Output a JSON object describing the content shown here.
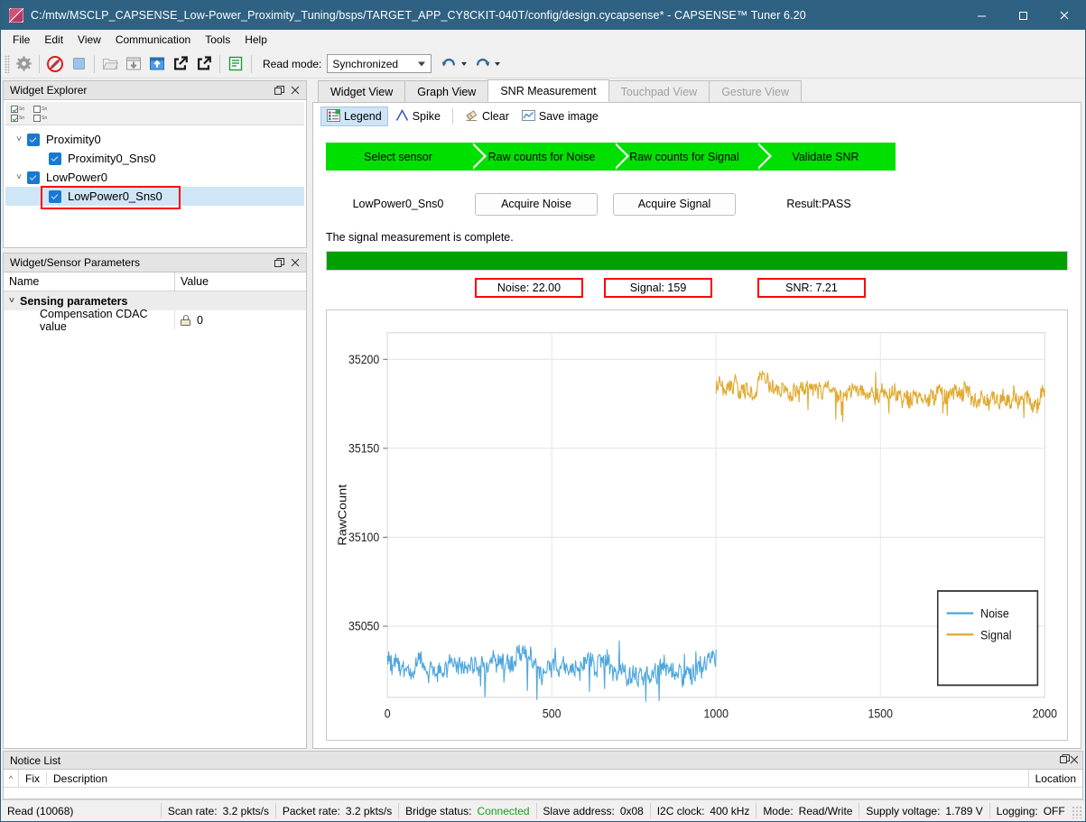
{
  "window": {
    "title": "C:/mtw/MSCLP_CAPSENSE_Low-Power_Proximity_Tuning/bsps/TARGET_APP_CY8CKIT-040T/config/design.cycapsense* - CAPSENSE™ Tuner 6.20",
    "minimize": "—",
    "maximize": "□",
    "close": "✕"
  },
  "menu": {
    "items": [
      "File",
      "Edit",
      "View",
      "Communication",
      "Tools",
      "Help"
    ]
  },
  "toolbar": {
    "icons": [
      "gear-icon",
      "disconnect-icon",
      "stop-icon",
      "open-file-icon",
      "read-from-device-icon",
      "write-to-device-icon",
      "import-icon",
      "export-icon",
      "log-icon"
    ],
    "read_mode_label": "Read mode:",
    "read_mode_value": "Synchronized",
    "undo_label": "Undo",
    "redo_label": "Redo"
  },
  "widget_explorer": {
    "title": "Widget Explorer",
    "check_all_label": "Sn",
    "uncheck_all_label": "Sn",
    "tree": [
      {
        "label": "Proximity0",
        "level": 0,
        "expander": "˅",
        "checked": true,
        "selected": false,
        "highlight": false
      },
      {
        "label": "Proximity0_Sns0",
        "level": 1,
        "expander": "",
        "checked": true,
        "selected": false,
        "highlight": false
      },
      {
        "label": "LowPower0",
        "level": 0,
        "expander": "˅",
        "checked": true,
        "selected": false,
        "highlight": false
      },
      {
        "label": "LowPower0_Sns0",
        "level": 1,
        "expander": "",
        "checked": true,
        "selected": true,
        "highlight": true
      }
    ]
  },
  "params": {
    "title": "Widget/Sensor Parameters",
    "columns": [
      "Name",
      "Value"
    ],
    "group": "Sensing parameters",
    "group_expander": "˅",
    "rows": [
      {
        "name": "Compensation CDAC value",
        "value": "0",
        "locked": true
      }
    ]
  },
  "tabs": [
    {
      "label": "Widget View",
      "active": false,
      "disabled": false
    },
    {
      "label": "Graph View",
      "active": false,
      "disabled": false
    },
    {
      "label": "SNR Measurement",
      "active": true,
      "disabled": false
    },
    {
      "label": "Touchpad View",
      "active": false,
      "disabled": true
    },
    {
      "label": "Gesture View",
      "active": false,
      "disabled": true
    }
  ],
  "subtoolbar": [
    {
      "label": "Legend",
      "icon": "legend-icon",
      "active": true
    },
    {
      "label": "Spike",
      "icon": "spike-icon",
      "active": false
    },
    {
      "label": "Clear",
      "icon": "eraser-icon",
      "active": false
    },
    {
      "label": "Save image",
      "icon": "save-image-icon",
      "active": false
    }
  ],
  "snr": {
    "steps": [
      "Select sensor",
      "Raw counts for Noise",
      "Raw counts for Signal",
      "Validate SNR"
    ],
    "step_color": "#00e000",
    "sensor_name": "LowPower0_Sns0",
    "acquire_noise_label": "Acquire Noise",
    "acquire_signal_label": "Acquire Signal",
    "result_label": "Result:PASS",
    "status_message": "The signal measurement is complete.",
    "progress_percent": 100,
    "progress_color": "#00a000",
    "metrics": [
      {
        "label": "Noise:  22.00",
        "name": "noise"
      },
      {
        "label": "Signal:  159",
        "name": "signal"
      },
      {
        "label": "SNR:  7.21",
        "name": "snr"
      }
    ],
    "highlight_color": "#ff0000"
  },
  "chart_data": {
    "type": "line",
    "title": "",
    "xlabel": "",
    "ylabel": "RawCount",
    "xlim": [
      0,
      2000
    ],
    "ylim": [
      35010,
      35215
    ],
    "xticks": [
      0,
      500,
      1000,
      1500,
      2000
    ],
    "yticks": [
      35050,
      35100,
      35150,
      35200
    ],
    "grid": true,
    "legend_position": "bottom-right",
    "series": [
      {
        "name": "Noise",
        "color": "#4ea6dd",
        "x_start": 0,
        "x_end": 1000,
        "mean": 35028,
        "amplitude": 9,
        "label": "Noise"
      },
      {
        "name": "Signal",
        "color": "#e0a92e",
        "x_start": 1000,
        "x_end": 2000,
        "mean": 35185,
        "amplitude": 8,
        "label": "Signal"
      }
    ]
  },
  "notice_list": {
    "title": "Notice List",
    "columns": [
      "Fix",
      "Description",
      "Location"
    ],
    "rows": []
  },
  "statusbar": [
    {
      "label": "Read (10068)",
      "value": "",
      "name": "read-count"
    },
    {
      "label": "Scan rate:",
      "value": "3.2 pkts/s",
      "name": "scan-rate"
    },
    {
      "label": "Packet rate:",
      "value": "3.2 pkts/s",
      "name": "packet-rate"
    },
    {
      "label": "Bridge status:",
      "value": "Connected",
      "name": "bridge-status",
      "value_color": "green"
    },
    {
      "label": "Slave address:",
      "value": "0x08",
      "name": "slave-address"
    },
    {
      "label": "I2C clock:",
      "value": "400 kHz",
      "name": "i2c-clock"
    },
    {
      "label": "Mode:",
      "value": "Read/Write",
      "name": "mode"
    },
    {
      "label": "Supply voltage:",
      "value": "1.789 V",
      "name": "supply-voltage"
    },
    {
      "label": "Logging:",
      "value": "OFF",
      "name": "logging"
    }
  ]
}
